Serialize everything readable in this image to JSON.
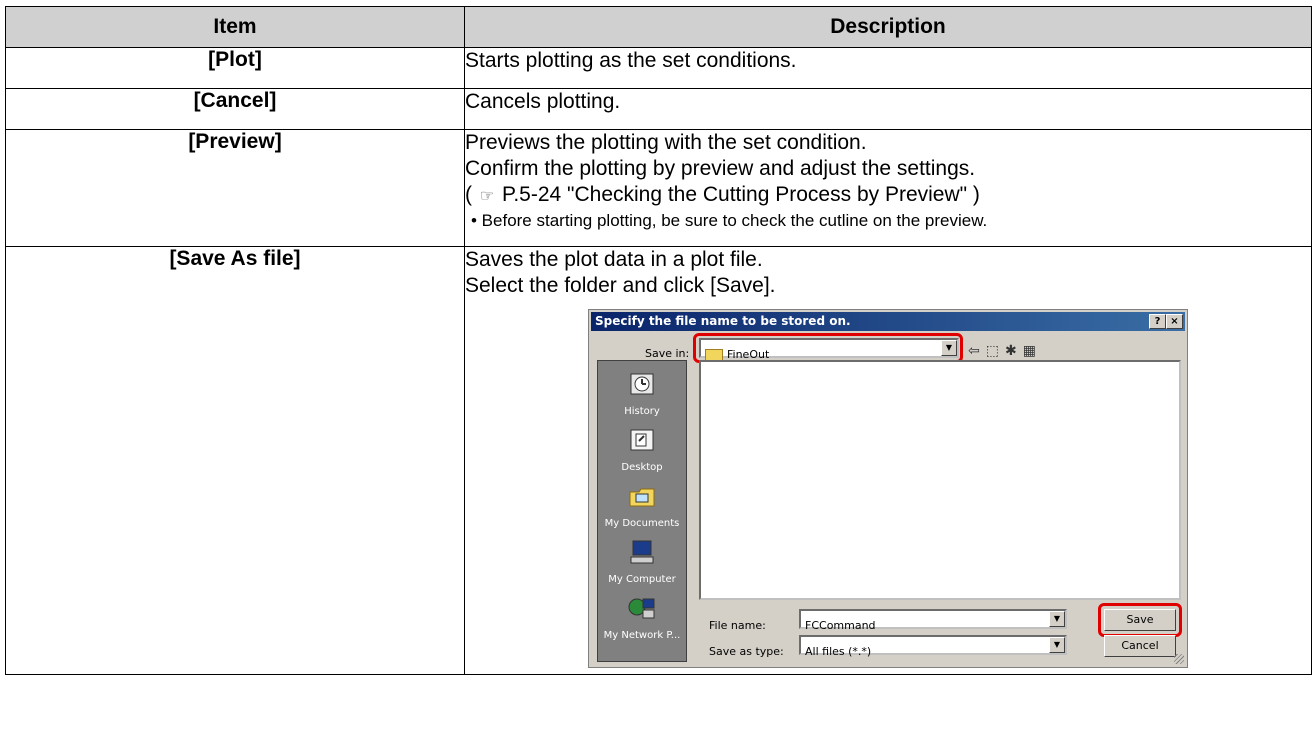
{
  "table": {
    "headers": [
      "Item",
      "Description"
    ],
    "rows": [
      {
        "item": "[Plot]",
        "lines": [
          "Starts plotting as the set conditions."
        ]
      },
      {
        "item": "[Cancel]",
        "lines": [
          "Cancels plotting."
        ]
      },
      {
        "item": "[Preview]",
        "lines": [
          "Previews the plotting with the set condition.",
          "Confirm the plotting by preview and adjust the settings."
        ],
        "ref": "P.5-24 \"Checking the Cutting Process by Preview\" )",
        "note": "• Before starting plotting, be sure to check the cutline on the preview."
      },
      {
        "item": "[Save As file]",
        "lines": [
          "Saves the plot data in a plot file.",
          "Select the folder and click [Save]."
        ]
      }
    ]
  },
  "dialog": {
    "title": "Specify the file name to be stored on.",
    "help_btn": "?",
    "close_btn": "×",
    "save_in_label": "Save in:",
    "save_in_value": "FineOut",
    "places": [
      "History",
      "Desktop",
      "My Documents",
      "My Computer",
      "My Network P..."
    ],
    "file_name_label": "File name:",
    "file_name_value": "FCCommand",
    "save_type_label": "Save as type:",
    "save_type_value": "All files (*.*)",
    "save_button": "Save",
    "cancel_button": "Cancel"
  },
  "colors": {
    "header_bg": "#d0d0d0",
    "highlight": "#e00000",
    "titlebar": "#0a246a"
  }
}
